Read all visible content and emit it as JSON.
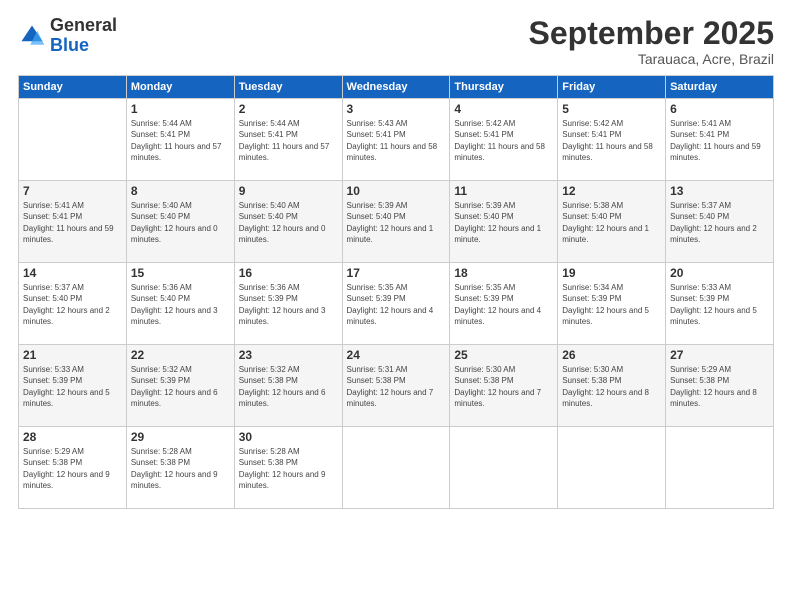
{
  "header": {
    "logo_general": "General",
    "logo_blue": "Blue",
    "month": "September 2025",
    "location": "Tarauaca, Acre, Brazil"
  },
  "weekdays": [
    "Sunday",
    "Monday",
    "Tuesday",
    "Wednesday",
    "Thursday",
    "Friday",
    "Saturday"
  ],
  "weeks": [
    [
      {
        "day": "",
        "sunrise": "",
        "sunset": "",
        "daylight": ""
      },
      {
        "day": "1",
        "sunrise": "Sunrise: 5:44 AM",
        "sunset": "Sunset: 5:41 PM",
        "daylight": "Daylight: 11 hours and 57 minutes."
      },
      {
        "day": "2",
        "sunrise": "Sunrise: 5:44 AM",
        "sunset": "Sunset: 5:41 PM",
        "daylight": "Daylight: 11 hours and 57 minutes."
      },
      {
        "day": "3",
        "sunrise": "Sunrise: 5:43 AM",
        "sunset": "Sunset: 5:41 PM",
        "daylight": "Daylight: 11 hours and 58 minutes."
      },
      {
        "day": "4",
        "sunrise": "Sunrise: 5:42 AM",
        "sunset": "Sunset: 5:41 PM",
        "daylight": "Daylight: 11 hours and 58 minutes."
      },
      {
        "day": "5",
        "sunrise": "Sunrise: 5:42 AM",
        "sunset": "Sunset: 5:41 PM",
        "daylight": "Daylight: 11 hours and 58 minutes."
      },
      {
        "day": "6",
        "sunrise": "Sunrise: 5:41 AM",
        "sunset": "Sunset: 5:41 PM",
        "daylight": "Daylight: 11 hours and 59 minutes."
      }
    ],
    [
      {
        "day": "7",
        "sunrise": "Sunrise: 5:41 AM",
        "sunset": "Sunset: 5:41 PM",
        "daylight": "Daylight: 11 hours and 59 minutes."
      },
      {
        "day": "8",
        "sunrise": "Sunrise: 5:40 AM",
        "sunset": "Sunset: 5:40 PM",
        "daylight": "Daylight: 12 hours and 0 minutes."
      },
      {
        "day": "9",
        "sunrise": "Sunrise: 5:40 AM",
        "sunset": "Sunset: 5:40 PM",
        "daylight": "Daylight: 12 hours and 0 minutes."
      },
      {
        "day": "10",
        "sunrise": "Sunrise: 5:39 AM",
        "sunset": "Sunset: 5:40 PM",
        "daylight": "Daylight: 12 hours and 1 minute."
      },
      {
        "day": "11",
        "sunrise": "Sunrise: 5:39 AM",
        "sunset": "Sunset: 5:40 PM",
        "daylight": "Daylight: 12 hours and 1 minute."
      },
      {
        "day": "12",
        "sunrise": "Sunrise: 5:38 AM",
        "sunset": "Sunset: 5:40 PM",
        "daylight": "Daylight: 12 hours and 1 minute."
      },
      {
        "day": "13",
        "sunrise": "Sunrise: 5:37 AM",
        "sunset": "Sunset: 5:40 PM",
        "daylight": "Daylight: 12 hours and 2 minutes."
      }
    ],
    [
      {
        "day": "14",
        "sunrise": "Sunrise: 5:37 AM",
        "sunset": "Sunset: 5:40 PM",
        "daylight": "Daylight: 12 hours and 2 minutes."
      },
      {
        "day": "15",
        "sunrise": "Sunrise: 5:36 AM",
        "sunset": "Sunset: 5:40 PM",
        "daylight": "Daylight: 12 hours and 3 minutes."
      },
      {
        "day": "16",
        "sunrise": "Sunrise: 5:36 AM",
        "sunset": "Sunset: 5:39 PM",
        "daylight": "Daylight: 12 hours and 3 minutes."
      },
      {
        "day": "17",
        "sunrise": "Sunrise: 5:35 AM",
        "sunset": "Sunset: 5:39 PM",
        "daylight": "Daylight: 12 hours and 4 minutes."
      },
      {
        "day": "18",
        "sunrise": "Sunrise: 5:35 AM",
        "sunset": "Sunset: 5:39 PM",
        "daylight": "Daylight: 12 hours and 4 minutes."
      },
      {
        "day": "19",
        "sunrise": "Sunrise: 5:34 AM",
        "sunset": "Sunset: 5:39 PM",
        "daylight": "Daylight: 12 hours and 5 minutes."
      },
      {
        "day": "20",
        "sunrise": "Sunrise: 5:33 AM",
        "sunset": "Sunset: 5:39 PM",
        "daylight": "Daylight: 12 hours and 5 minutes."
      }
    ],
    [
      {
        "day": "21",
        "sunrise": "Sunrise: 5:33 AM",
        "sunset": "Sunset: 5:39 PM",
        "daylight": "Daylight: 12 hours and 5 minutes."
      },
      {
        "day": "22",
        "sunrise": "Sunrise: 5:32 AM",
        "sunset": "Sunset: 5:39 PM",
        "daylight": "Daylight: 12 hours and 6 minutes."
      },
      {
        "day": "23",
        "sunrise": "Sunrise: 5:32 AM",
        "sunset": "Sunset: 5:38 PM",
        "daylight": "Daylight: 12 hours and 6 minutes."
      },
      {
        "day": "24",
        "sunrise": "Sunrise: 5:31 AM",
        "sunset": "Sunset: 5:38 PM",
        "daylight": "Daylight: 12 hours and 7 minutes."
      },
      {
        "day": "25",
        "sunrise": "Sunrise: 5:30 AM",
        "sunset": "Sunset: 5:38 PM",
        "daylight": "Daylight: 12 hours and 7 minutes."
      },
      {
        "day": "26",
        "sunrise": "Sunrise: 5:30 AM",
        "sunset": "Sunset: 5:38 PM",
        "daylight": "Daylight: 12 hours and 8 minutes."
      },
      {
        "day": "27",
        "sunrise": "Sunrise: 5:29 AM",
        "sunset": "Sunset: 5:38 PM",
        "daylight": "Daylight: 12 hours and 8 minutes."
      }
    ],
    [
      {
        "day": "28",
        "sunrise": "Sunrise: 5:29 AM",
        "sunset": "Sunset: 5:38 PM",
        "daylight": "Daylight: 12 hours and 9 minutes."
      },
      {
        "day": "29",
        "sunrise": "Sunrise: 5:28 AM",
        "sunset": "Sunset: 5:38 PM",
        "daylight": "Daylight: 12 hours and 9 minutes."
      },
      {
        "day": "30",
        "sunrise": "Sunrise: 5:28 AM",
        "sunset": "Sunset: 5:38 PM",
        "daylight": "Daylight: 12 hours and 9 minutes."
      },
      {
        "day": "",
        "sunrise": "",
        "sunset": "",
        "daylight": ""
      },
      {
        "day": "",
        "sunrise": "",
        "sunset": "",
        "daylight": ""
      },
      {
        "day": "",
        "sunrise": "",
        "sunset": "",
        "daylight": ""
      },
      {
        "day": "",
        "sunrise": "",
        "sunset": "",
        "daylight": ""
      }
    ]
  ]
}
